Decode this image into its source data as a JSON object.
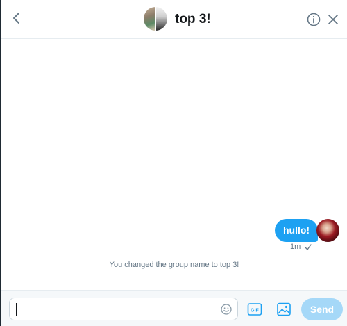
{
  "header": {
    "title": "top 3!",
    "back_icon": "chevron-left-icon",
    "info_icon": "info-icon",
    "close_icon": "close-icon"
  },
  "conversation": {
    "messages": [
      {
        "text": "hullo!",
        "time": "1m",
        "status_icon": "checkmark-icon",
        "from_self": true
      }
    ],
    "system_notice": "You changed the group name to top 3!"
  },
  "composer": {
    "input_value": "",
    "input_placeholder": "",
    "emoji_icon": "emoji-icon",
    "gif_label": "GIF",
    "image_icon": "image-icon",
    "send_label": "Send"
  },
  "colors": {
    "accent": "#1da1f2",
    "accent_disabled": "#a5d8f8",
    "text_primary": "#14171a",
    "text_secondary": "#657786",
    "composer_bg": "#f5f8fa",
    "divider": "#e6ecf0"
  }
}
